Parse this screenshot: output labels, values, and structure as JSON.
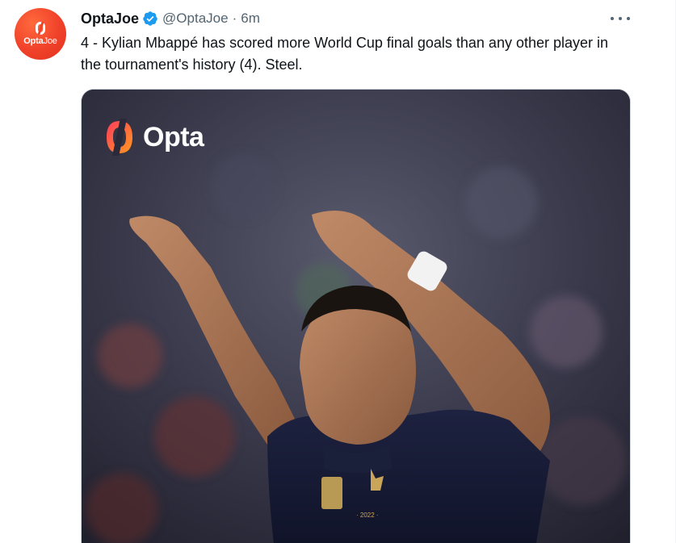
{
  "tweet": {
    "avatar": {
      "wordmark_bold": "Opta",
      "wordmark_light": "Joe",
      "icon": "opta-logo-icon",
      "background_color": "#f0412a"
    },
    "display_name": "OptaJoe",
    "verified_icon": "verified-badge-icon",
    "handle": "@OptaJoe",
    "separator": "·",
    "time": "6m",
    "more_icon": "more-options-icon",
    "text": "4 - Kylian Mbappé has scored more World Cup final goals than any other player in the tournament's history (4). Steel.",
    "media": {
      "logo_text": "Opta",
      "logo_icon": "opta-logo-icon",
      "image": "photo of footballer in dark blue France shirt raising both arms"
    }
  },
  "colors": {
    "verified": "#1d9bf0",
    "secondary_text": "#536471",
    "primary_text": "#0f1419",
    "opta_gradient_start": "#ff3b5c",
    "opta_gradient_end": "#ff9a1f"
  }
}
